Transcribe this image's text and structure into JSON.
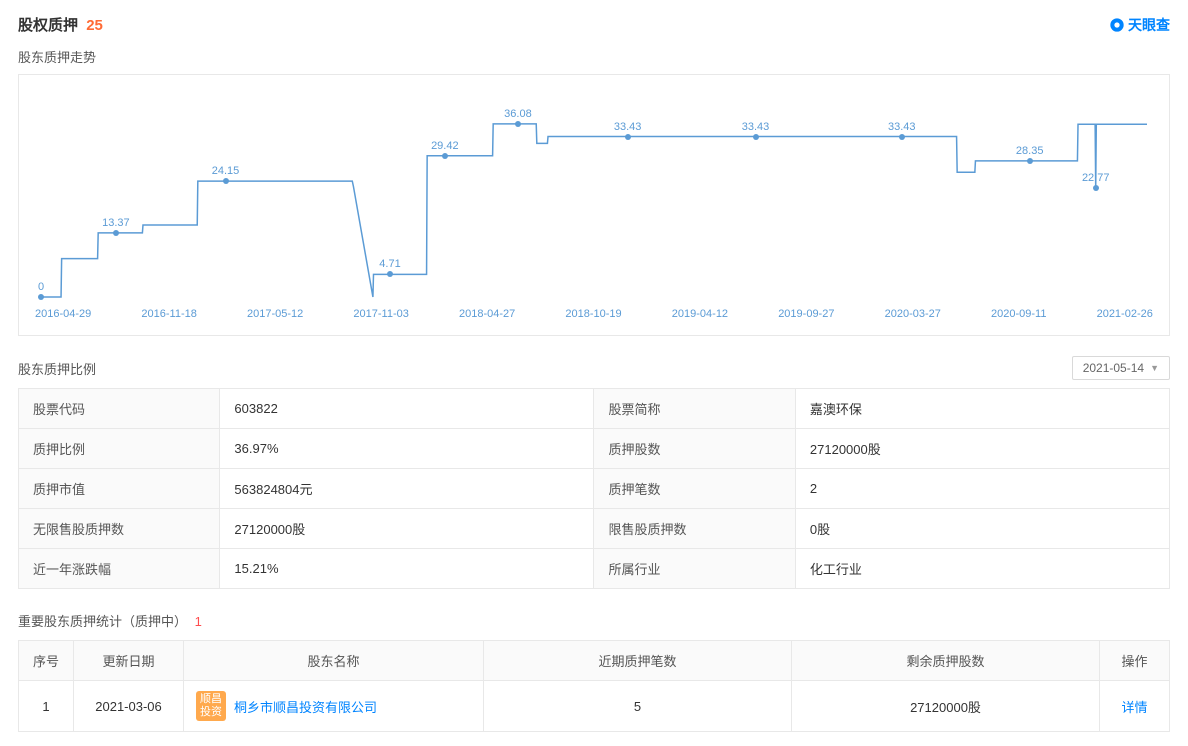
{
  "header": {
    "title": "股权质押",
    "count": "25",
    "brand": "天眼查"
  },
  "trend": {
    "subtitle": "股东质押走势"
  },
  "chart_data": {
    "type": "line",
    "title": "股东质押走势",
    "xlabel": "",
    "ylabel": "",
    "ylim": [
      0,
      40
    ],
    "x_ticks": [
      "2016-04-29",
      "2016-11-18",
      "2017-05-12",
      "2017-11-03",
      "2018-04-27",
      "2018-10-19",
      "2019-04-12",
      "2019-09-27",
      "2020-03-27",
      "2020-09-11",
      "2021-02-26"
    ],
    "annotations": [
      {
        "x": "2016-04-29",
        "y": 0,
        "label": "0"
      },
      {
        "x": "2016-09-01",
        "y": 13.37,
        "label": "13.37"
      },
      {
        "x": "2017-03-01",
        "y": 24.15,
        "label": "24.15"
      },
      {
        "x": "2017-12-01",
        "y": 4.71,
        "label": "4.71"
      },
      {
        "x": "2018-03-01",
        "y": 29.42,
        "label": "29.42"
      },
      {
        "x": "2018-07-01",
        "y": 36.08,
        "label": "36.08"
      },
      {
        "x": "2019-01-01",
        "y": 33.43,
        "label": "33.43"
      },
      {
        "x": "2019-08-01",
        "y": 33.43,
        "label": "33.43"
      },
      {
        "x": "2020-04-01",
        "y": 33.43,
        "label": "33.43"
      },
      {
        "x": "2020-11-01",
        "y": 28.35,
        "label": "28.35"
      },
      {
        "x": "2021-02-20",
        "y": 22.77,
        "label": "22.77"
      }
    ],
    "series": [
      {
        "name": "pledge_ratio",
        "points": [
          {
            "x": "2016-04-29",
            "y": 0
          },
          {
            "x": "2016-06-01",
            "y": 0
          },
          {
            "x": "2016-06-02",
            "y": 8
          },
          {
            "x": "2016-08-01",
            "y": 8
          },
          {
            "x": "2016-08-02",
            "y": 13.37
          },
          {
            "x": "2016-10-15",
            "y": 13.37
          },
          {
            "x": "2016-10-16",
            "y": 15
          },
          {
            "x": "2017-01-15",
            "y": 15
          },
          {
            "x": "2017-01-16",
            "y": 24.15
          },
          {
            "x": "2017-09-30",
            "y": 24.15
          },
          {
            "x": "2017-10-01",
            "y": 23
          },
          {
            "x": "2017-11-03",
            "y": 0
          },
          {
            "x": "2017-11-04",
            "y": 4.71
          },
          {
            "x": "2018-02-01",
            "y": 4.71
          },
          {
            "x": "2018-02-02",
            "y": 29.42
          },
          {
            "x": "2018-05-20",
            "y": 29.42
          },
          {
            "x": "2018-05-21",
            "y": 36.08
          },
          {
            "x": "2018-08-01",
            "y": 36.08
          },
          {
            "x": "2018-08-02",
            "y": 32
          },
          {
            "x": "2018-08-20",
            "y": 32
          },
          {
            "x": "2018-08-21",
            "y": 33.43
          },
          {
            "x": "2020-07-01",
            "y": 33.43
          },
          {
            "x": "2020-07-02",
            "y": 26
          },
          {
            "x": "2020-08-01",
            "y": 26
          },
          {
            "x": "2020-08-02",
            "y": 28.35
          },
          {
            "x": "2021-01-20",
            "y": 28.35
          },
          {
            "x": "2021-01-21",
            "y": 36
          },
          {
            "x": "2021-02-19",
            "y": 36
          },
          {
            "x": "2021-02-20",
            "y": 22.77
          },
          {
            "x": "2021-02-21",
            "y": 36
          },
          {
            "x": "2021-05-14",
            "y": 36
          }
        ]
      }
    ]
  },
  "ratio_section": {
    "title": "股东质押比例",
    "date_selected": "2021-05-14",
    "rows": [
      {
        "k1": "股票代码",
        "v1": "603822",
        "k2": "股票简称",
        "v2": "嘉澳环保"
      },
      {
        "k1": "质押比例",
        "v1": "36.97%",
        "k2": "质押股数",
        "v2": "27120000股"
      },
      {
        "k1": "质押市值",
        "v1": "563824804元",
        "k2": "质押笔数",
        "v2": "2"
      },
      {
        "k1": "无限售股质押数",
        "v1": "27120000股",
        "k2": "限售股质押数",
        "v2": "0股"
      },
      {
        "k1": "近一年涨跌幅",
        "v1": "15.21%",
        "k2": "所属行业",
        "v2": "化工行业"
      }
    ]
  },
  "stats_section": {
    "title": "重要股东质押统计（质押中）",
    "count": "1",
    "cols": {
      "idx": "序号",
      "date": "更新日期",
      "name": "股东名称",
      "recent": "近期质押笔数",
      "remain": "剩余质押股数",
      "op": "操作"
    },
    "rows": [
      {
        "idx": "1",
        "date": "2021-03-06",
        "logo": "顺昌投资",
        "name": "桐乡市顺昌投资有限公司",
        "recent": "5",
        "remain": "27120000股",
        "op": "详情"
      }
    ]
  }
}
